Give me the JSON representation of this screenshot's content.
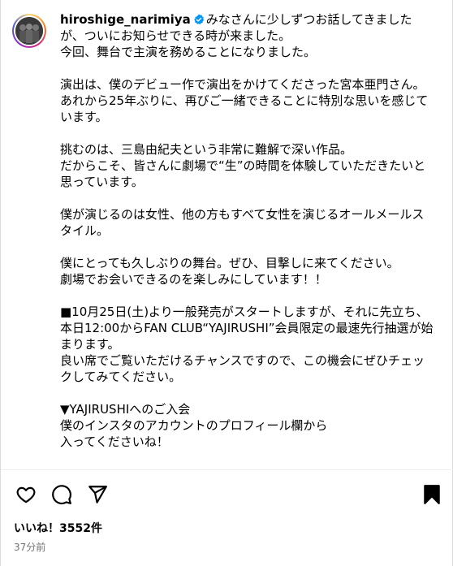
{
  "post": {
    "username": "hiroshige_narimiya",
    "caption": "みなさんに少しずつお話してきましたが、ついにお知らせできる時が来ました。\n今回、舞台で主演を務めることになりました。\n\n演出は、僕のデビュー作で演出をかけてくださった宮本亜門さん。あれから25年ぶりに、再びご一緒できることに特別な思いを感じています。\n\n挑むのは、三島由紀夫という非常に難解で深い作品。\nだからこそ、皆さんに劇場で“生”の時間を体験していただきたいと思っています。\n\n僕が演じるのは女性、他の方もすべて女性を演じるオールメールスタイル。\n\n僕にとっても久しぶりの舞台。ぜひ、目撃しに来てください。\n劇場でお会いできるのを楽しみにしています！！\n\n■10月25日(土)より一般発売がスタートしますが、それに先立ち、本日12:00からFAN CLUB“YAJIRUSHI”会員限定の最速先行抽選が始まります。\n良い席でご覧いただけるチャンスですので、この機会にぜひチェックしてみてください。\n\n▼YAJIRUSHIへのご入会\n僕のインスタのアカウントのプロフィール欄から\n入ってくださいね！",
    "likes": "いいね！3552件",
    "time_ago": "37分前"
  },
  "colors": {
    "verified": "#0095f6",
    "muted_text": "#737373",
    "divider": "#efefef"
  },
  "icons": {
    "like": "heart-icon",
    "comment": "comment-icon",
    "share": "paper-plane-icon",
    "save": "bookmark-icon",
    "verified": "verified-badge-icon"
  }
}
